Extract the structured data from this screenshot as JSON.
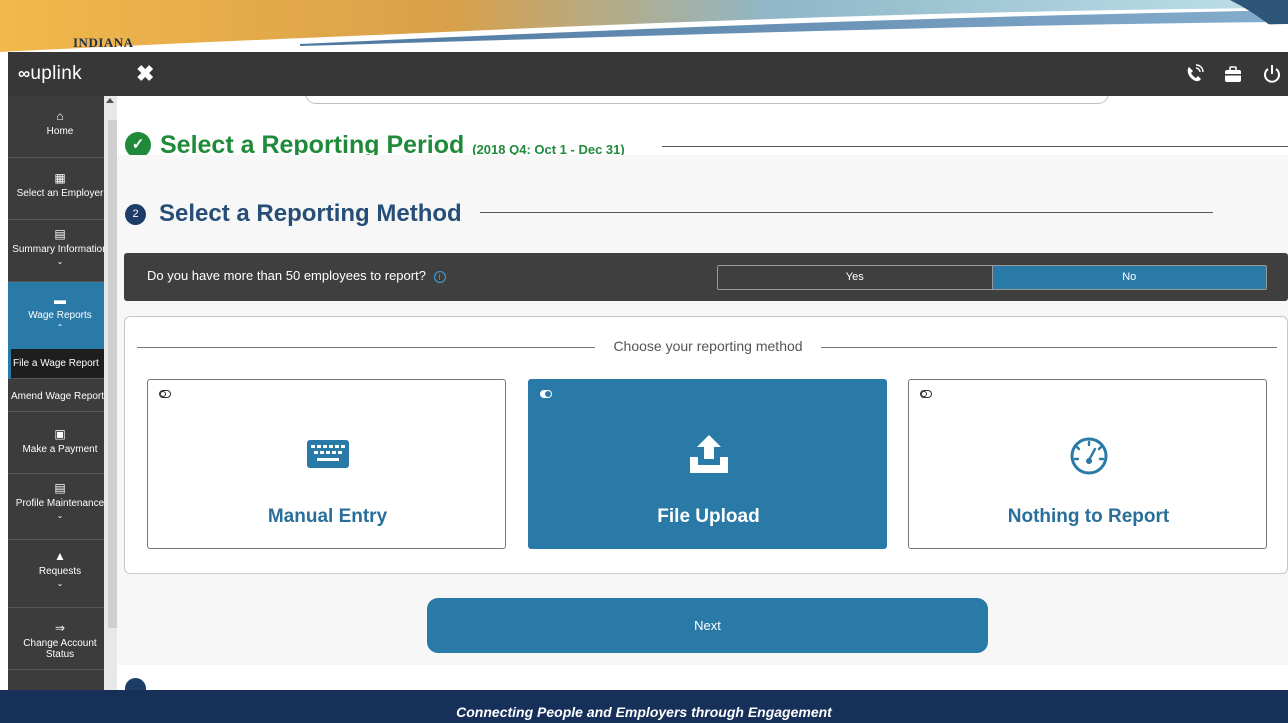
{
  "banner": {
    "state_name": "INDIANA"
  },
  "app": {
    "logo_prefix": "∞",
    "logo_text": "uplink",
    "close_glyph": "✖",
    "toolbar_icons": [
      "phone-icon",
      "briefcase-icon",
      "power-icon"
    ]
  },
  "sidebar": {
    "items": [
      {
        "label": "Home",
        "icon": "home-icon"
      },
      {
        "label": "Select an Employer",
        "icon": "building-icon"
      },
      {
        "label": "Summary Information",
        "icon": "document-icon",
        "expandable": true
      },
      {
        "label": "Wage Reports",
        "icon": "folder-icon",
        "expanded": true
      },
      {
        "label": "Make a Payment",
        "icon": "payment-icon"
      },
      {
        "label": "Profile Maintenance",
        "icon": "profile-icon",
        "expandable": true
      },
      {
        "label": "Requests",
        "icon": "requests-icon",
        "expandable": true
      },
      {
        "label": "Change Account Status",
        "icon": "exchange-icon"
      }
    ],
    "subitems": [
      {
        "label": "File a Wage Report",
        "current": true
      },
      {
        "label": "Amend Wage Report",
        "current": false
      }
    ]
  },
  "section1": {
    "title": "Select a Reporting Period",
    "subtitle": "(2018 Q4: Oct 1 - Dec 31)"
  },
  "section2": {
    "step": "2",
    "title": "Select a Reporting Method"
  },
  "question": {
    "text": "Do you have more than 50 employees to report?",
    "info": "i",
    "yes": "Yes",
    "no": "No",
    "selected": "No"
  },
  "methods": {
    "legend": "Choose your reporting method",
    "options": [
      {
        "label": "Manual Entry",
        "icon": "keyboard-icon",
        "selected": false
      },
      {
        "label": "File Upload",
        "icon": "upload-icon",
        "selected": true
      },
      {
        "label": "Nothing to Report",
        "icon": "gauge-icon",
        "selected": false
      }
    ]
  },
  "next_label": "Next",
  "footer": {
    "tagline": "Connecting People and Employers through Engagement"
  },
  "colors": {
    "accent": "#2a7aa7",
    "success": "#1f8a3a",
    "heading": "#274e77",
    "footer": "#16305a"
  }
}
